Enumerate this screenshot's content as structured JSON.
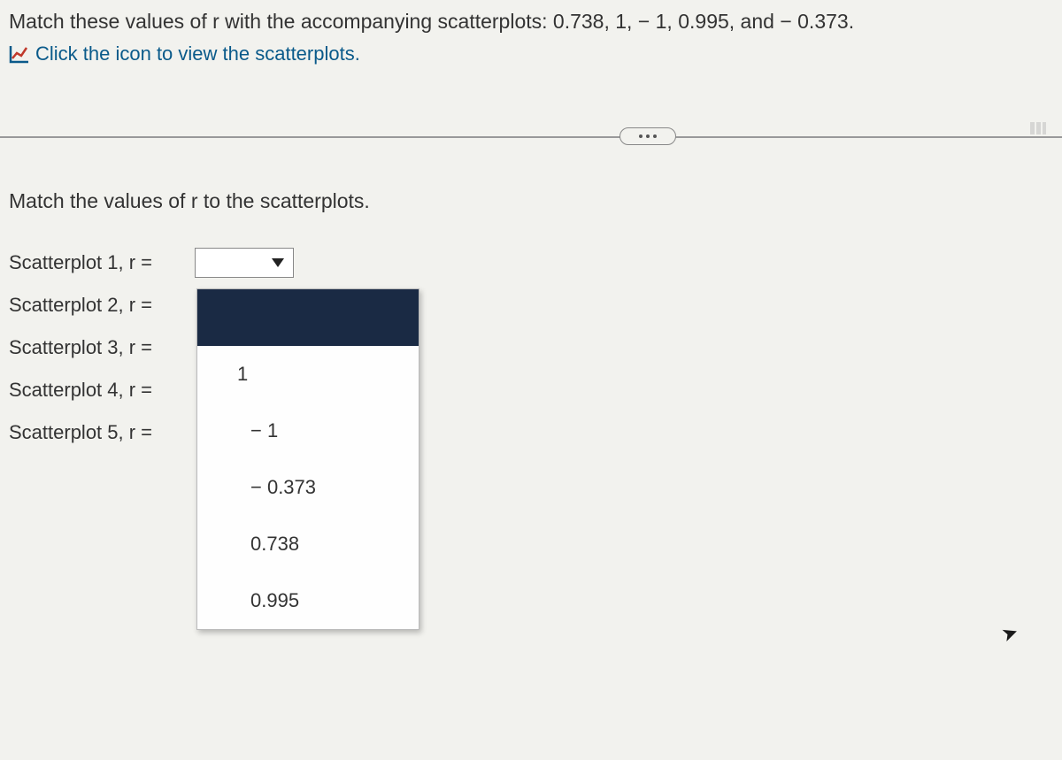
{
  "question": {
    "text": "Match these values of r with the accompanying scatterplots: 0.738, 1, − 1, 0.995, and − 0.373.",
    "link": "Click the icon to view the scatterplots."
  },
  "instruction": "Match the values of r to the scatterplots.",
  "rows": [
    {
      "label": "Scatterplot 1, r ="
    },
    {
      "label": "Scatterplot 2, r ="
    },
    {
      "label": "Scatterplot 3, r ="
    },
    {
      "label": "Scatterplot 4, r ="
    },
    {
      "label": "Scatterplot 5, r ="
    }
  ],
  "dropdown": {
    "options": [
      "",
      "1",
      "− 1",
      "− 0.373",
      "0.738",
      "0.995"
    ],
    "selectedIndex": 0
  }
}
